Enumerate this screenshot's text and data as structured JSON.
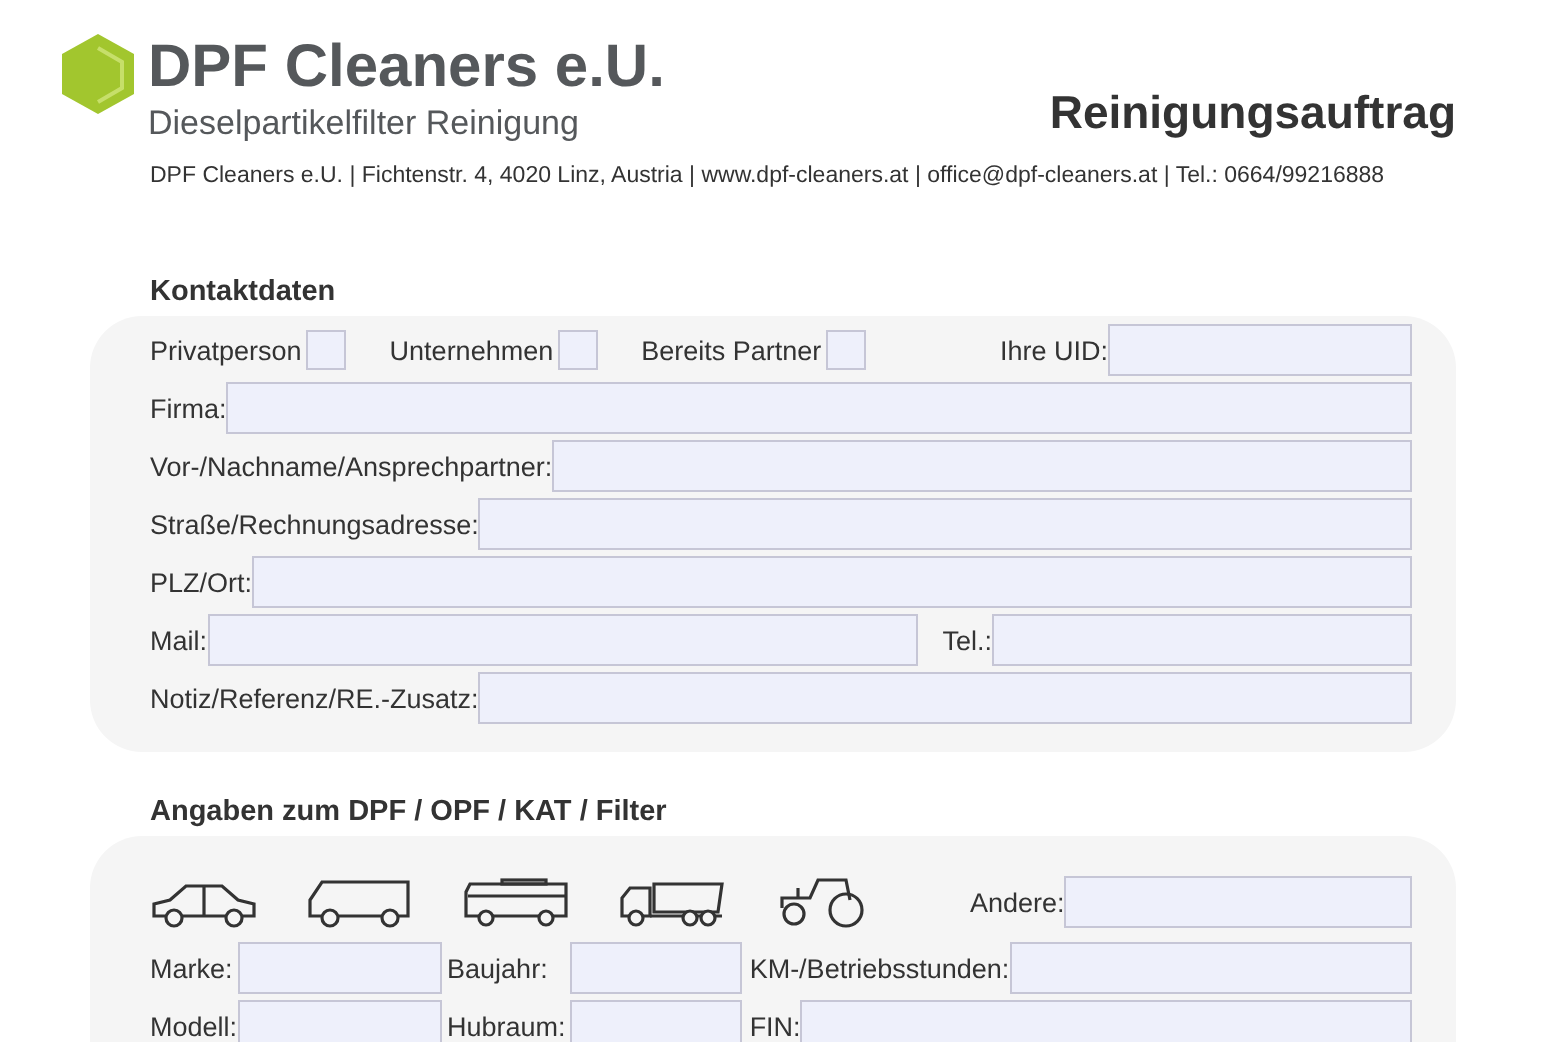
{
  "header": {
    "company": "DPF Cleaners e.U.",
    "tagline": "Dieselpartikelfilter Reinigung",
    "title": "Reinigungsauftrag",
    "address": "DPF Cleaners e.U. | Fichtenstr. 4, 4020 Linz, Austria | www.dpf-cleaners.at | office@dpf-cleaners.at | Tel.: 0664/99216888"
  },
  "contact": {
    "heading": "Kontaktdaten",
    "options": [
      {
        "label": "Privatperson",
        "checked": false
      },
      {
        "label": "Unternehmen",
        "checked": false
      },
      {
        "label": "Bereits Partner",
        "checked": false
      }
    ],
    "uid_label": "Ihre UID:",
    "rows": [
      [
        {
          "label": "Firma:"
        }
      ],
      [
        {
          "label": "Vor-/Nachname/Ansprechpartner:"
        }
      ],
      [
        {
          "label": "Straße/Rechnungsadresse:"
        }
      ],
      [
        {
          "label": "PLZ/Ort:"
        }
      ],
      [
        {
          "label": "Mail:"
        },
        {
          "label": "Tel.:"
        }
      ],
      [
        {
          "label": "Notiz/Referenz/RE.-Zusatz:"
        }
      ]
    ]
  },
  "vehicle": {
    "heading": "Angaben zum DPF / OPF / KAT / Filter",
    "types": [
      {
        "kind": "car"
      },
      {
        "kind": "van"
      },
      {
        "kind": "bus"
      },
      {
        "kind": "truck"
      },
      {
        "kind": "tractor"
      }
    ],
    "other_label": "Andere:",
    "rows": [
      [
        {
          "label": "Marke:"
        },
        {
          "label": "Baujahr:"
        },
        {
          "label": "KM-/Betriebsstunden:"
        }
      ],
      [
        {
          "label": "Modell:"
        },
        {
          "label": "Hubraum:"
        },
        {
          "label": "FIN:"
        }
      ]
    ]
  }
}
